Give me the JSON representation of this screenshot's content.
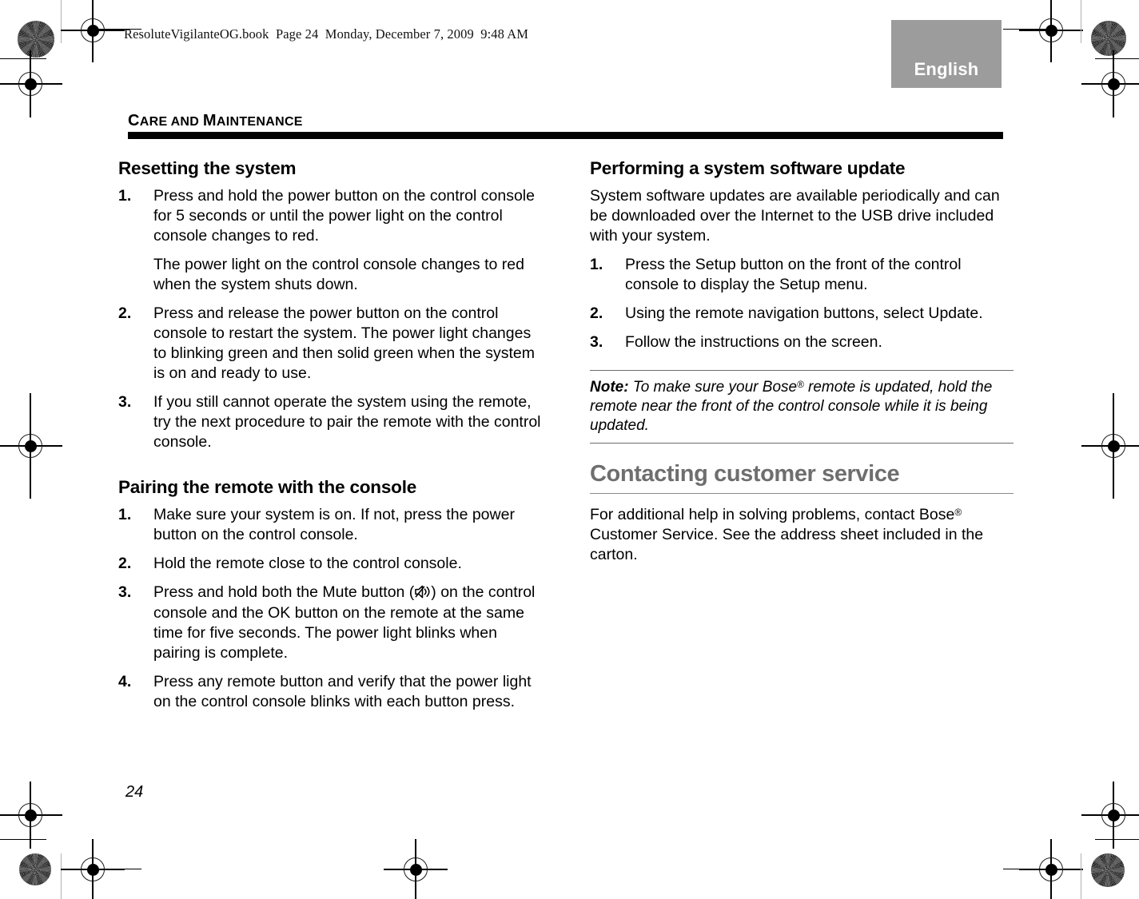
{
  "book_header": "ResoluteVigilanteOG.book  Page 24  Monday, December 7, 2009  9:48 AM",
  "language_tab": {
    "label": "English",
    "background_color": "#9c9c9c",
    "text_color": "#ffffff"
  },
  "running_head": {
    "first_letter_1": "C",
    "rest_1": "ARE AND ",
    "first_letter_2": "M",
    "rest_2": "AINTENANCE",
    "full_text": "CARE AND MAINTENANCE"
  },
  "folio": "24",
  "left_column": {
    "sections": [
      {
        "heading": "Resetting the system",
        "steps": [
          {
            "number": "1.",
            "text": "Press and hold the power button on the control console for 5 seconds or until the power light on the control console changes to red.",
            "sub_paragraph": "The power light on the control console changes to red when the system shuts down."
          },
          {
            "number": "2.",
            "text": "Press and release the power button on the control console to restart the system. The power light changes to blinking green and then solid green when the system is on and ready to use."
          },
          {
            "number": "3.",
            "text": "If you still cannot operate the system using the remote, try the next procedure to pair the remote with the control console."
          }
        ]
      },
      {
        "heading": "Pairing the remote with the console",
        "steps": [
          {
            "number": "1.",
            "text": "Make sure your system is on. If not, press the power button on the control console."
          },
          {
            "number": "2.",
            "text": "Hold the remote close to the control console."
          },
          {
            "number": "3.",
            "text_before_icon": "Press and hold both the Mute button (",
            "icon": "mute-speaker-icon",
            "text_after_icon": ") on the control console and the OK button on the remote at the same time for five seconds. The power light blinks when pairing is complete."
          },
          {
            "number": "4.",
            "text": "Press any remote button and verify that the power light on the control console blinks with each button press."
          }
        ]
      }
    ]
  },
  "right_column": {
    "section_heading": "Performing a system software update",
    "intro_paragraph": "System software updates are available periodically and can be downloaded over the Internet to the USB drive included with your system.",
    "steps": [
      {
        "number": "1.",
        "text": "Press the Setup button on the front of the control console to display the Setup menu."
      },
      {
        "number": "2.",
        "text": "Using the remote navigation buttons, select Update."
      },
      {
        "number": "3.",
        "text": "Follow the instructions on the screen."
      }
    ],
    "note": {
      "label": "Note:",
      "text_part1": "To make sure your Bose",
      "registered_mark": "®",
      "text_part2": " remote is updated, hold the remote near the front of the control console while it is being updated."
    },
    "major_heading": "Contacting customer service",
    "major_heading_color": "#6e6e6e",
    "closing_paragraph_part1": "For additional help in solving problems, contact Bose",
    "closing_registered_mark": "®",
    "closing_paragraph_part2": " Customer Service. See the address sheet included in the carton."
  }
}
